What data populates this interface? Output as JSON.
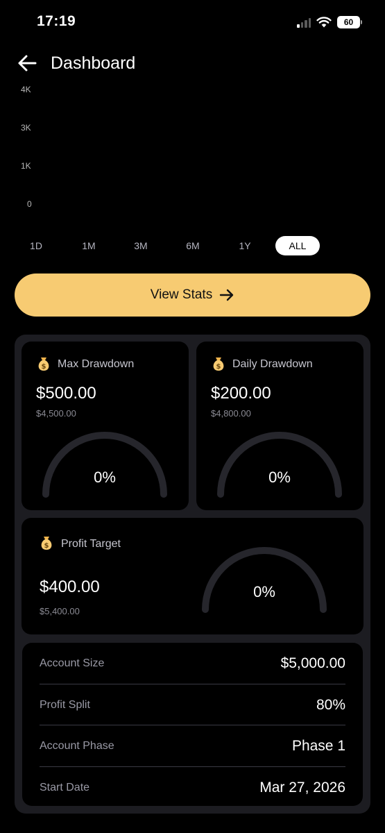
{
  "status_bar": {
    "time": "17:19",
    "battery": "60"
  },
  "header": {
    "title": "Dashboard"
  },
  "chart_data": {
    "type": "line",
    "y_ticks": [
      "4K",
      "3K",
      "1K",
      "0"
    ],
    "series": []
  },
  "time_ranges": [
    {
      "label": "1D",
      "active": false
    },
    {
      "label": "1M",
      "active": false
    },
    {
      "label": "3M",
      "active": false
    },
    {
      "label": "6M",
      "active": false
    },
    {
      "label": "1Y",
      "active": false
    },
    {
      "label": "ALL",
      "active": true
    }
  ],
  "view_stats": {
    "label": "View Stats"
  },
  "max_drawdown": {
    "title": "Max Drawdown",
    "amount": "$500.00",
    "sub": "$4,500.00",
    "percent": "0%",
    "progress": 0
  },
  "daily_drawdown": {
    "title": "Daily Drawdown",
    "amount": "$200.00",
    "sub": "$4,800.00",
    "percent": "0%",
    "progress": 0
  },
  "profit_target": {
    "title": "Profit Target",
    "amount": "$400.00",
    "sub": "$5,400.00",
    "percent": "0%",
    "progress": 0
  },
  "account_details": [
    {
      "label": "Account Size",
      "value": "$5,000.00"
    },
    {
      "label": "Profit Split",
      "value": "80%"
    },
    {
      "label": "Account Phase",
      "value": "Phase 1"
    },
    {
      "label": "Start Date",
      "value": "Mar 27, 2026"
    }
  ],
  "colors": {
    "accent": "#f7cb72",
    "background": "#000000",
    "panel": "#1c1c21",
    "gauge_track": "#26262c"
  },
  "icons": {
    "back": "arrow-left-icon",
    "money_bag": "money-bag-icon",
    "arrow_right": "arrow-right-icon"
  }
}
